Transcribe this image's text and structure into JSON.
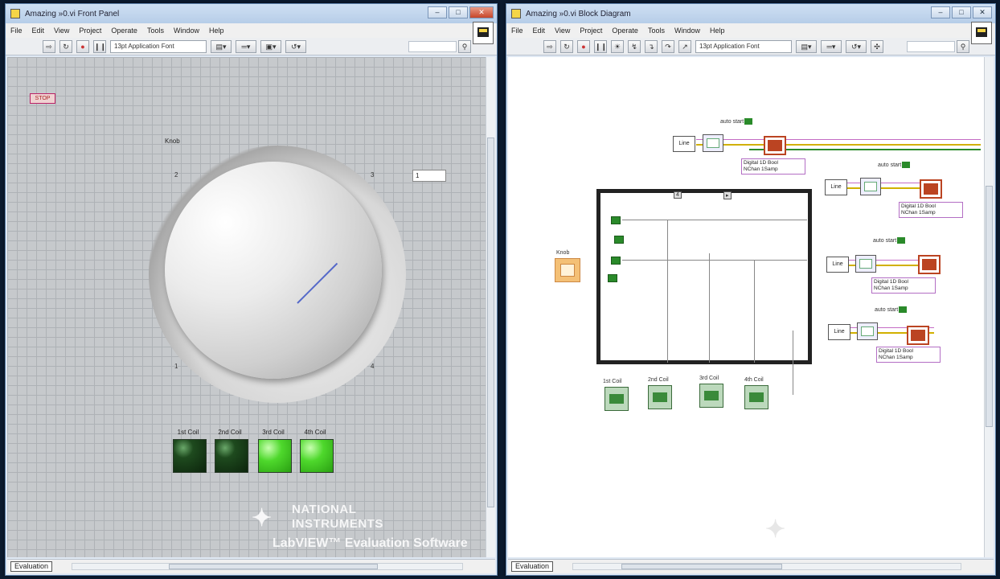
{
  "front_panel": {
    "title": "Amazing »0.vi Front Panel",
    "menu": [
      "File",
      "Edit",
      "View",
      "Project",
      "Operate",
      "Tools",
      "Window",
      "Help"
    ],
    "font_select": "13pt Application Font",
    "stop_label": "STOP",
    "knob": {
      "label": "Knob",
      "ticks": [
        "2",
        "3",
        "1",
        "4"
      ],
      "digital_value": "1"
    },
    "leds": [
      {
        "label": "1st Coil",
        "state": "off"
      },
      {
        "label": "2nd Coil",
        "state": "off"
      },
      {
        "label": "3rd Coil",
        "state": "on"
      },
      {
        "label": "4th Coil",
        "state": "on"
      }
    ],
    "watermark": {
      "line1": "NATIONAL",
      "line2": "INSTRUMENTS",
      "sub": "LabVIEW™ Evaluation Software"
    },
    "status_label": "Evaluation"
  },
  "block_diagram": {
    "title": "Amazing »0.vi Block Diagram",
    "menu": [
      "File",
      "Edit",
      "View",
      "Project",
      "Operate",
      "Tools",
      "Window",
      "Help"
    ],
    "font_select": "13pt Application Font",
    "knob_label": "Knob",
    "ref_label": "Line",
    "autostart_label": "auto start",
    "autostart_value": "T",
    "daq_select": "Digital 1D Bool\nNChan 1Samp",
    "loop_left_label": "4",
    "loop_right_label": "▸",
    "indicators": [
      "1st Coil",
      "2nd Coil",
      "3rd Coil",
      "4th Coil"
    ],
    "status_label": "Evaluation"
  },
  "colors": {
    "led_on": "#4ed82c",
    "led_off": "#1e4a1e",
    "daq_red": "#b42222",
    "bool_green": "#2a8a2a",
    "select_border": "#b36ec4",
    "canvas_fp": "#c6c9cc"
  }
}
